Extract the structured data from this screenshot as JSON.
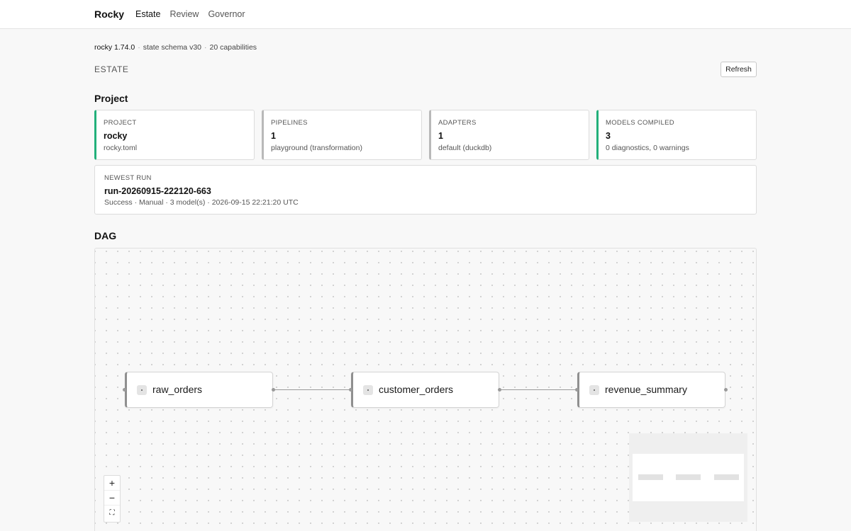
{
  "header": {
    "brand": "Rocky",
    "nav": [
      {
        "label": "Estate",
        "active": true
      },
      {
        "label": "Review",
        "active": false
      },
      {
        "label": "Governor",
        "active": false
      }
    ]
  },
  "meta": {
    "version": "rocky 1.74.0",
    "schema": "state schema v30",
    "capabilities": "20 capabilities",
    "separator": "·"
  },
  "estate": {
    "heading": "ESTATE",
    "refresh_label": "Refresh"
  },
  "project": {
    "title": "Project",
    "cards": [
      {
        "label": "PROJECT",
        "value": "rocky",
        "sub": "rocky.toml",
        "accent": "#22b07a"
      },
      {
        "label": "PIPELINES",
        "value": "1",
        "sub": "playground (transformation)",
        "accent": "#b9b9b9"
      },
      {
        "label": "ADAPTERS",
        "value": "1",
        "sub": "default (duckdb)",
        "accent": "#b9b9b9"
      },
      {
        "label": "MODELS COMPILED",
        "value": "3",
        "sub": "0 diagnostics, 0 warnings",
        "accent": "#22b07a"
      }
    ],
    "newest_run": {
      "label": "NEWEST RUN",
      "value": "run-20260915-222120-663",
      "sub": "Success · Manual · 3 model(s) · 2026-09-15 22:21:20 UTC"
    }
  },
  "dag": {
    "title": "DAG",
    "nodes": [
      {
        "name": "raw_orders",
        "icon": "model-icon"
      },
      {
        "name": "customer_orders",
        "icon": "model-icon"
      },
      {
        "name": "revenue_summary",
        "icon": "model-icon"
      }
    ],
    "edges": [
      [
        "raw_orders",
        "customer_orders"
      ],
      [
        "customer_orders",
        "revenue_summary"
      ]
    ],
    "controls": [
      {
        "glyph": "+",
        "icon": "zoom-in-icon"
      },
      {
        "glyph": "−",
        "icon": "zoom-out-icon"
      },
      {
        "glyph": "⛶",
        "icon": "fit-view-icon"
      }
    ]
  }
}
